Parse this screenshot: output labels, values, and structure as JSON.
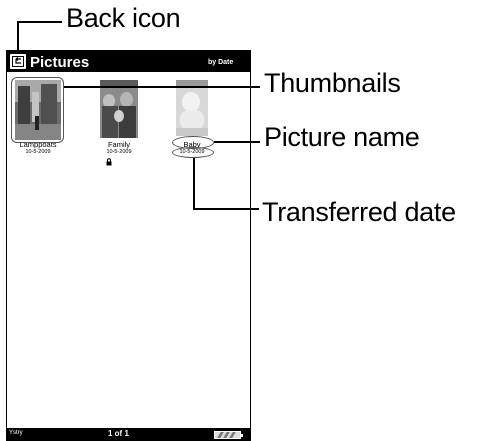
{
  "header": {
    "title": "Pictures",
    "sort_label": "by Date"
  },
  "pictures": [
    {
      "name": "Lamppoats",
      "date": "10-5-2009",
      "locked": false
    },
    {
      "name": "Family",
      "date": "10-5-2009",
      "locked": true
    },
    {
      "name": "Baby",
      "date": "10-5-2009",
      "locked": false
    }
  ],
  "footer": {
    "signal": "Ystry",
    "page_indicator": "1 of 1"
  },
  "callouts": {
    "back_icon": "Back icon",
    "thumbnails": "Thumbnails",
    "picture_name": "Picture name",
    "transferred_date": "Transferred date"
  },
  "icons": [
    "back-icon",
    "lock-icon",
    "battery-icon",
    "signal-icon"
  ],
  "colors": {
    "bar": "#000000",
    "screen": "#ffffff"
  }
}
